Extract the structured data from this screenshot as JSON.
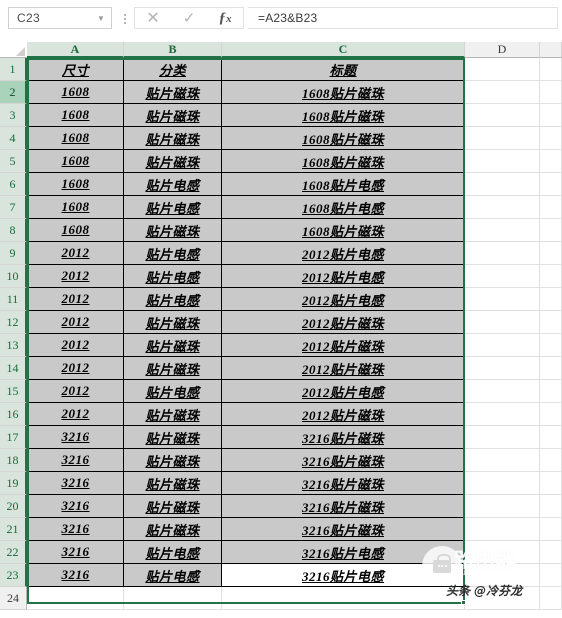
{
  "app": "excel-spreadsheet",
  "formula_bar": {
    "name_box_value": "C23",
    "name_box_dropdown_icon": "chevron-down-icon",
    "more_options_icon": "vertical-dots-icon",
    "cancel_icon": "close-icon",
    "enter_icon": "check-icon",
    "insert_function_icon": "fx-icon",
    "formula_value": "=A23&B23",
    "formula_placeholder": ""
  },
  "grid": {
    "column_headers": [
      {
        "label": "A",
        "selected": true
      },
      {
        "label": "B",
        "selected": true
      },
      {
        "label": "C",
        "selected": true
      },
      {
        "label": "D",
        "selected": false
      },
      {
        "label": "",
        "selected": false
      }
    ],
    "row_headers": [
      {
        "label": "1",
        "selected": true,
        "active": false
      },
      {
        "label": "2",
        "selected": true,
        "active": true
      },
      {
        "label": "3",
        "selected": true,
        "active": false
      },
      {
        "label": "4",
        "selected": true,
        "active": false
      },
      {
        "label": "5",
        "selected": true,
        "active": false
      },
      {
        "label": "6",
        "selected": true,
        "active": false
      },
      {
        "label": "7",
        "selected": true,
        "active": false
      },
      {
        "label": "8",
        "selected": true,
        "active": false
      },
      {
        "label": "9",
        "selected": true,
        "active": false
      },
      {
        "label": "10",
        "selected": true,
        "active": false
      },
      {
        "label": "11",
        "selected": true,
        "active": false
      },
      {
        "label": "12",
        "selected": true,
        "active": false
      },
      {
        "label": "13",
        "selected": true,
        "active": false
      },
      {
        "label": "14",
        "selected": true,
        "active": false
      },
      {
        "label": "15",
        "selected": true,
        "active": false
      },
      {
        "label": "16",
        "selected": true,
        "active": false
      },
      {
        "label": "17",
        "selected": true,
        "active": false
      },
      {
        "label": "18",
        "selected": true,
        "active": false
      },
      {
        "label": "19",
        "selected": true,
        "active": false
      },
      {
        "label": "20",
        "selected": true,
        "active": false
      },
      {
        "label": "21",
        "selected": true,
        "active": false
      },
      {
        "label": "22",
        "selected": true,
        "active": false
      },
      {
        "label": "23",
        "selected": true,
        "active": false
      },
      {
        "label": "24",
        "selected": false,
        "active": false
      }
    ],
    "selection_range": "A1:C23",
    "active_cell": "C23",
    "rows": [
      {
        "row": "1",
        "a": "尺寸",
        "b": "分类",
        "c": "标题",
        "filled": true
      },
      {
        "row": "2",
        "a": "1608",
        "b": "贴片磁珠",
        "c": "1608贴片磁珠",
        "filled": true
      },
      {
        "row": "3",
        "a": "1608",
        "b": "贴片磁珠",
        "c": "1608贴片磁珠",
        "filled": true
      },
      {
        "row": "4",
        "a": "1608",
        "b": "贴片磁珠",
        "c": "1608贴片磁珠",
        "filled": true
      },
      {
        "row": "5",
        "a": "1608",
        "b": "贴片磁珠",
        "c": "1608贴片磁珠",
        "filled": true
      },
      {
        "row": "6",
        "a": "1608",
        "b": "贴片电感",
        "c": "1608贴片电感",
        "filled": true
      },
      {
        "row": "7",
        "a": "1608",
        "b": "贴片电感",
        "c": "1608贴片电感",
        "filled": true
      },
      {
        "row": "8",
        "a": "1608",
        "b": "贴片磁珠",
        "c": "1608贴片磁珠",
        "filled": true
      },
      {
        "row": "9",
        "a": "2012",
        "b": "贴片电感",
        "c": "2012贴片电感",
        "filled": true
      },
      {
        "row": "10",
        "a": "2012",
        "b": "贴片电感",
        "c": "2012贴片电感",
        "filled": true
      },
      {
        "row": "11",
        "a": "2012",
        "b": "贴片电感",
        "c": "2012贴片电感",
        "filled": true
      },
      {
        "row": "12",
        "a": "2012",
        "b": "贴片磁珠",
        "c": "2012贴片磁珠",
        "filled": true
      },
      {
        "row": "13",
        "a": "2012",
        "b": "贴片磁珠",
        "c": "2012贴片磁珠",
        "filled": true
      },
      {
        "row": "14",
        "a": "2012",
        "b": "贴片磁珠",
        "c": "2012贴片磁珠",
        "filled": true
      },
      {
        "row": "15",
        "a": "2012",
        "b": "贴片电感",
        "c": "2012贴片电感",
        "filled": true
      },
      {
        "row": "16",
        "a": "2012",
        "b": "贴片磁珠",
        "c": "2012贴片磁珠",
        "filled": true
      },
      {
        "row": "17",
        "a": "3216",
        "b": "贴片磁珠",
        "c": "3216贴片磁珠",
        "filled": true
      },
      {
        "row": "18",
        "a": "3216",
        "b": "贴片磁珠",
        "c": "3216贴片磁珠",
        "filled": true
      },
      {
        "row": "19",
        "a": "3216",
        "b": "贴片磁珠",
        "c": "3216贴片磁珠",
        "filled": true
      },
      {
        "row": "20",
        "a": "3216",
        "b": "贴片磁珠",
        "c": "3216贴片磁珠",
        "filled": true
      },
      {
        "row": "21",
        "a": "3216",
        "b": "贴片磁珠",
        "c": "3216贴片磁珠",
        "filled": true
      },
      {
        "row": "22",
        "a": "3216",
        "b": "贴片电感",
        "c": "3216贴片电感",
        "filled": true
      },
      {
        "row": "23",
        "a": "3216",
        "b": "贴片电感",
        "c": "3216贴片电感",
        "filled": true
      },
      {
        "row": "24",
        "a": "",
        "b": "",
        "c": "",
        "filled": false
      }
    ]
  },
  "watermark": {
    "logo_icon": "lock-icon",
    "title": "路由器",
    "subtitle": "luyouqi.com",
    "credit": "头条 @冷芬龙"
  },
  "colors": {
    "selection_green": "#217346",
    "header_selected": "#d8e4dc",
    "cell_fill": "#c9c9c9",
    "grid_line": "#e0e0e0"
  }
}
